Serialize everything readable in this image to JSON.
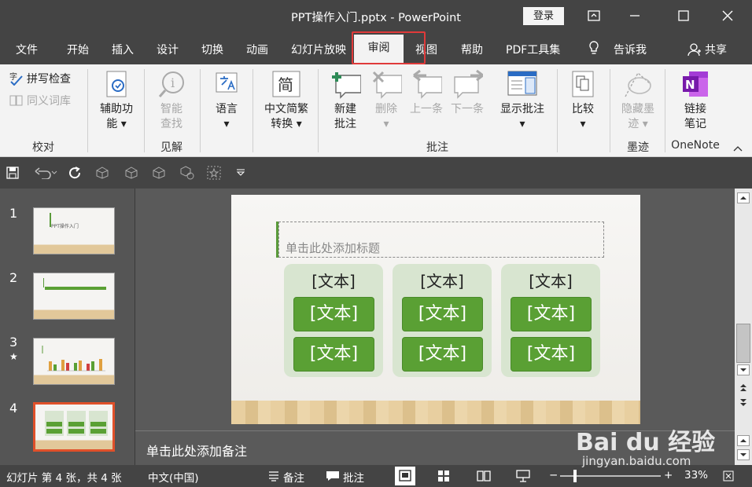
{
  "window": {
    "title": "PPT操作入门.pptx  -  PowerPoint",
    "login": "登录"
  },
  "tabs": [
    "文件",
    "开始",
    "插入",
    "设计",
    "切换",
    "动画",
    "幻灯片放映",
    "审阅",
    "视图",
    "帮助",
    "PDF工具集"
  ],
  "active_tab": "审阅",
  "tell_me": "告诉我",
  "share": "共享",
  "ribbon": {
    "proofing": {
      "spell": "拼写检查",
      "thesaurus": "同义词库",
      "label": "校对"
    },
    "accessibility": {
      "line1": "辅助功",
      "line2": "能 ▾"
    },
    "insights": {
      "line1": "智能",
      "line2": "查找",
      "label": "见解"
    },
    "language": {
      "line1": "语言",
      "line2": "▾"
    },
    "chinese": {
      "icon_char": "简",
      "line1": "中文简繁",
      "line2": "转换 ▾"
    },
    "comments": {
      "new_1": "新建",
      "new_2": "批注",
      "delete_1": "删除",
      "delete_2": "▾",
      "prev": "上一条",
      "next": "下一条",
      "show_1": "显示批注",
      "show_2": "▾",
      "label": "批注"
    },
    "compare": {
      "line1": "比较",
      "line2": "▾"
    },
    "ink": {
      "line1": "隐藏墨",
      "line2": "迹 ▾",
      "label": "墨迹"
    },
    "onenote": {
      "line1": "链接",
      "line2": "笔记",
      "label": "OneNote"
    }
  },
  "thumbnails": [
    {
      "num": "1",
      "text": "PPT操作入门"
    },
    {
      "num": "2",
      "text": ""
    },
    {
      "num": "3",
      "text": ""
    },
    {
      "num": "4",
      "text": ""
    }
  ],
  "slide": {
    "title_placeholder": "单击此处添加标题",
    "columns": [
      {
        "header": "[文本]",
        "btn1": "[文本]",
        "btn2": "[文本]"
      },
      {
        "header": "[文本]",
        "btn1": "[文本]",
        "btn2": "[文本]"
      },
      {
        "header": "[文本]",
        "btn1": "[文本]",
        "btn2": "[文本]"
      }
    ]
  },
  "notes_placeholder": "单击此处添加备注",
  "status": {
    "slide_info": "幻灯片 第 4 张，共 4 张",
    "language": "中文(中国)",
    "notes": "备注",
    "comments": "批注",
    "zoom": "33%"
  },
  "watermark": {
    "brand": "Bai du 经验",
    "url": "jingyan.baidu.com"
  },
  "colors": {
    "accent_green": "#5aa034",
    "title_bg": "#444444",
    "highlight_red": "#e03a3a"
  }
}
